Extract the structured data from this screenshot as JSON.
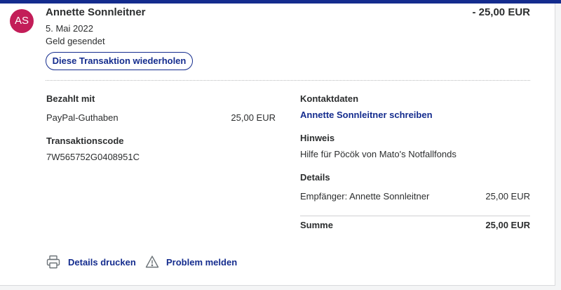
{
  "header": {
    "avatar_initials": "AS",
    "name": "Annette Sonnleitner",
    "amount": "- 25,00 EUR",
    "date": "5. Mai 2022",
    "type": "Geld gesendet",
    "repeat_button": "Diese Transaktion wiederholen"
  },
  "left": {
    "paid_with_label": "Bezahlt mit",
    "payment_source": "PayPal-Guthaben",
    "payment_amount": "25,00 EUR",
    "transaction_code_label": "Transaktionscode",
    "transaction_code": "7W565752G0408951C"
  },
  "right": {
    "contact_label": "Kontaktdaten",
    "contact_link": "Annette Sonnleitner schreiben",
    "note_label": "Hinweis",
    "note_text": "Hilfe für Pöcök von Mato's Notfallfonds",
    "details_label": "Details",
    "recipient_text": "Empfänger: Annette Sonnleitner",
    "recipient_amount": "25,00 EUR",
    "sum_label": "Summe",
    "sum_amount": "25,00 EUR"
  },
  "footer": {
    "print_label": "Details drucken",
    "report_label": "Problem melden",
    "print_icon": "printer-icon",
    "report_icon": "warning-icon"
  },
  "colors": {
    "brand": "#142c8e",
    "avatar": "#c31d58"
  }
}
